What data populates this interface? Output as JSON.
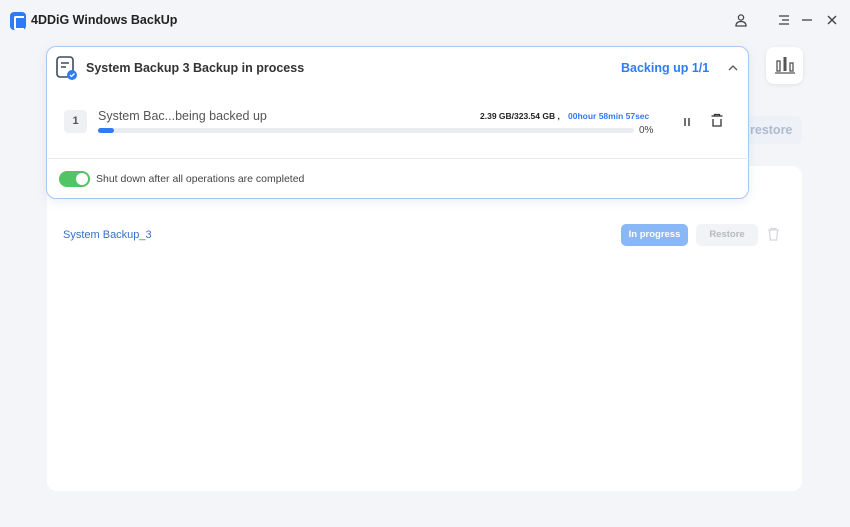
{
  "app": {
    "title": "4DDiG Windows BackUp"
  },
  "window_controls": {
    "account_icon": "user-icon",
    "menu_icon": "menu-icon",
    "minimize_icon": "minimize-icon",
    "close_icon": "close-icon"
  },
  "popup": {
    "title": "System Backup  3 Backup in process",
    "status": "Backing up  1/1",
    "task": {
      "index": "1",
      "name": "System Bac...being backed up",
      "size": "2.39 GB/323.54 GB ,",
      "time_remaining": "00hour 58min 57sec",
      "percent_text": "0%",
      "progress_fraction": 0.03
    },
    "shutdown_toggle": {
      "label": "Shut down after all operations are completed",
      "on": true
    }
  },
  "background": {
    "restore_button": "restore",
    "list": [
      {
        "name": "System Backup_3",
        "status_button": "In progress",
        "restore_button": "Restore"
      }
    ]
  },
  "colors": {
    "accent": "#2f7bf5",
    "toggle_on": "#52c463",
    "status_button": "#8ab7f5"
  }
}
